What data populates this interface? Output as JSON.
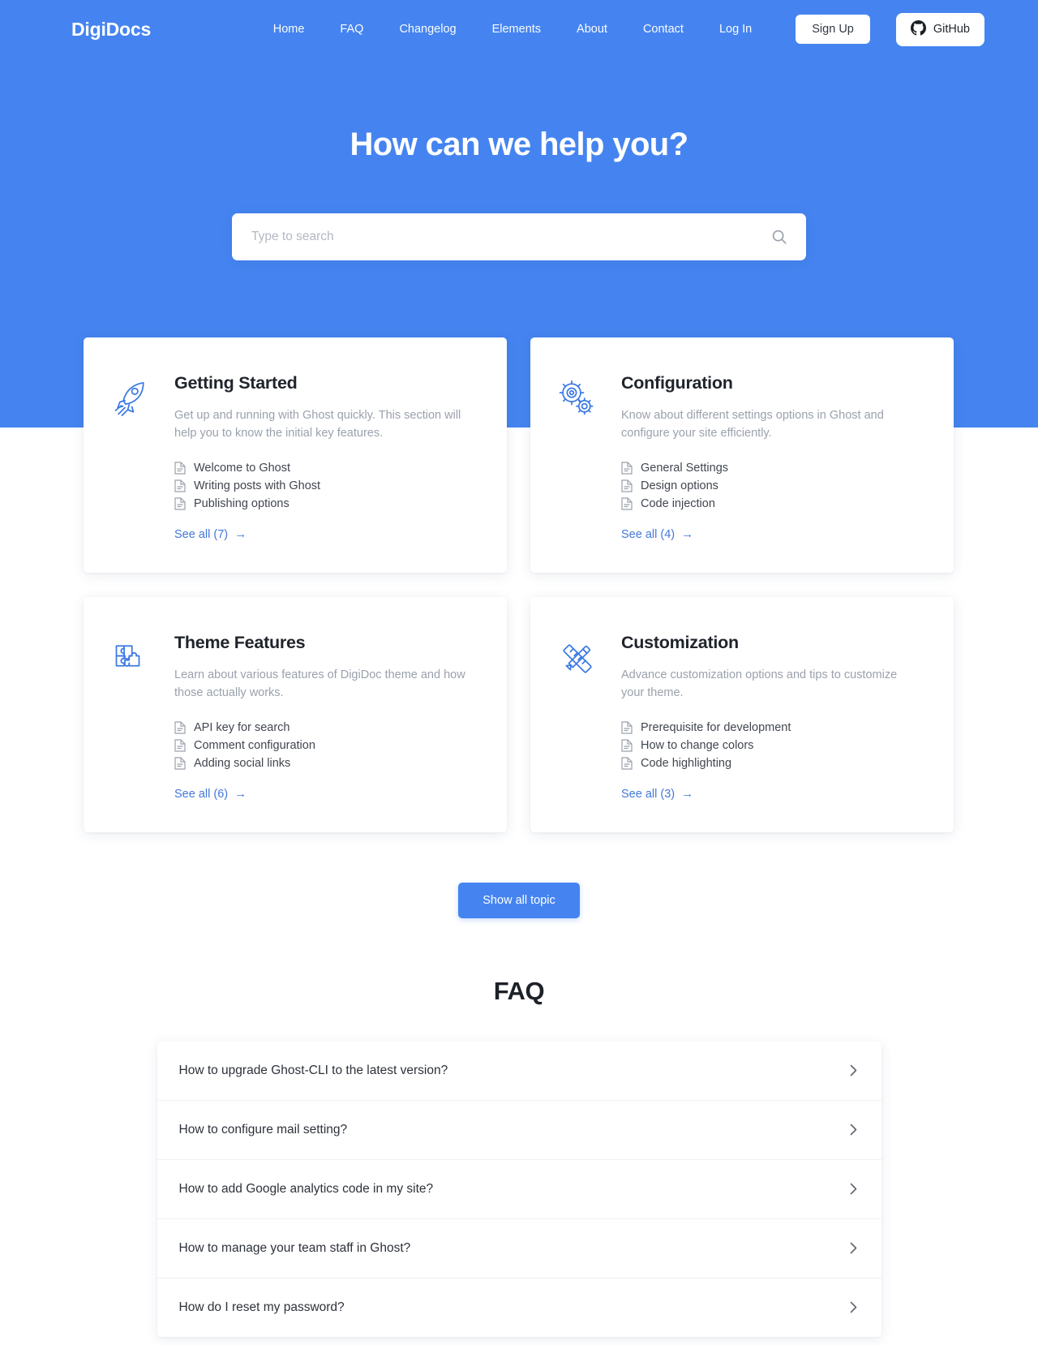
{
  "brand": "DigiDocs",
  "theme": {
    "hero_blue": "#4584f0",
    "link_blue": "#4378d8",
    "page_bg": "#ffffff",
    "title_dark": "#20242b",
    "muted_gray": "#9aa1ac"
  },
  "nav": {
    "links": [
      {
        "label": "Home"
      },
      {
        "label": "FAQ"
      },
      {
        "label": "Changelog"
      },
      {
        "label": "Elements"
      },
      {
        "label": "About"
      },
      {
        "label": "Contact"
      },
      {
        "label": "Log In"
      }
    ],
    "signup_label": "Sign Up",
    "github_label": "GitHub"
  },
  "hero": {
    "title": "How can we help you?",
    "search_placeholder": "Type to search",
    "search_value": ""
  },
  "topics": [
    {
      "icon": "rocket-icon",
      "title": "Getting Started",
      "description": "Get up and running with Ghost quickly. This section will help you to know the initial key features.",
      "articles": [
        "Welcome to Ghost",
        "Writing posts with Ghost",
        "Publishing options"
      ],
      "see_all": "See all (7)",
      "count": 7
    },
    {
      "icon": "gears-icon",
      "title": "Configuration",
      "description": "Know about different settings options in Ghost and configure your site efficiently.",
      "articles": [
        "General Settings",
        "Design options",
        "Code injection"
      ],
      "see_all": "See all (4)",
      "count": 4
    },
    {
      "icon": "puzzle-icon",
      "title": "Theme Features",
      "description": "Learn about various features of DigiDoc theme and how those actually works.",
      "articles": [
        "API key for search",
        "Comment configuration",
        "Adding social links"
      ],
      "see_all": "See all (6)",
      "count": 6
    },
    {
      "icon": "ruler-pencil-icon",
      "title": "Customization",
      "description": "Advance customization options and tips to customize your theme.",
      "articles": [
        "Prerequisite for development",
        "How to change colors",
        "Code highlighting"
      ],
      "see_all": "See all (3)",
      "count": 3
    }
  ],
  "show_all_label": "Show all topic",
  "faq": {
    "heading": "FAQ",
    "items": [
      {
        "question": "How to upgrade Ghost-CLI to the latest version?"
      },
      {
        "question": "How to configure mail setting?"
      },
      {
        "question": "How to add Google analytics code in my site?"
      },
      {
        "question": "How to manage your team staff in Ghost?"
      },
      {
        "question": "How do I reset my password?"
      }
    ]
  }
}
